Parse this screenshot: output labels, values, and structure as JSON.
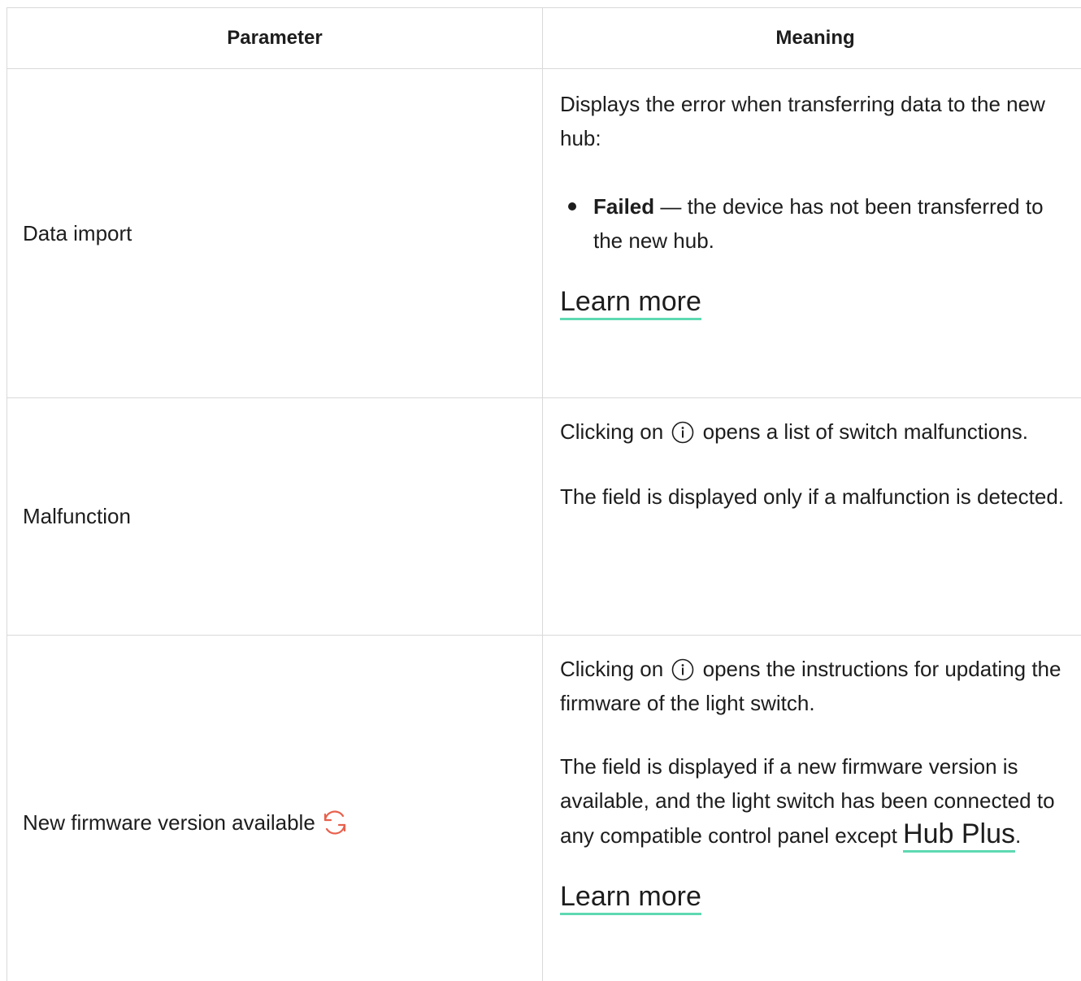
{
  "table": {
    "headers": {
      "parameter": "Parameter",
      "meaning": "Meaning"
    },
    "rows": [
      {
        "parameter": "Data import",
        "meaning_intro": "Displays the error when transferring data to the new hub:",
        "bullet_bold": "Failed",
        "bullet_text": " — the device has not been transferred to the new hub.",
        "link": "Learn more"
      },
      {
        "parameter": "Malfunction",
        "meaning_p1_before": "Clicking on ",
        "meaning_p1_after": " opens a list of switch malfunctions.",
        "meaning_p2": "The field is displayed only if a malfunction is detected."
      },
      {
        "parameter": "New firmware version available",
        "meaning_p1_before": "Clicking on ",
        "meaning_p1_after": " opens the instructions for updating the firmware of the light switch.",
        "meaning_p2": "The field is displayed if a new firmware version is available, and the light switch has been connected to any compatible control panel except",
        "inline_link": "Hub Plus",
        "inline_link_after": ".",
        "link": "Learn more"
      }
    ]
  },
  "colors": {
    "accent_underline": "#5ed9b1",
    "refresh_icon": "#e8604c",
    "border": "#d9d9d9"
  },
  "icons": [
    "info-icon",
    "refresh-icon"
  ]
}
